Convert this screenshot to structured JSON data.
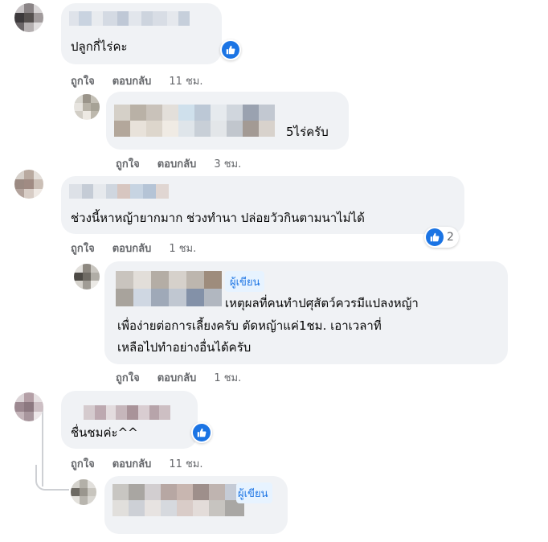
{
  "comments": [
    {
      "text": "ปลูกกี่ไร่คะ",
      "actions": {
        "like": "ถูกใจ",
        "reply": "ตอบกลับ",
        "time": "11 ชม."
      }
    },
    {
      "text": "5ไร่ครับ",
      "actions": {
        "like": "ถูกใจ",
        "reply": "ตอบกลับ",
        "time": "3 ชม."
      }
    },
    {
      "text": "ช่วงนี้หาหญ้ายากมาก ช่วงทำนา ปล่อยวัวกินตามนาไม่ได้",
      "reaction_count": "2",
      "actions": {
        "like": "ถูกใจ",
        "reply": "ตอบกลับ",
        "time": "1 ชม."
      }
    },
    {
      "author_badge": "ผู้เขียน",
      "lines": [
        "เหตุผลที่คนทำปศุสัตว์ควรมีแปลงหญ้า",
        "เพื่อง่ายต่อการเลี้ยงครับ ตัดหญ้าแค่1ชม. เอาเวลาที่",
        "เหลือไปทำอย่างอื่นได้ครับ"
      ],
      "actions": {
        "like": "ถูกใจ",
        "reply": "ตอบกลับ",
        "time": "1 ชม."
      }
    },
    {
      "text": "ชื่นชมค่ะ^^",
      "actions": {
        "like": "ถูกใจ",
        "reply": "ตอบกลับ",
        "time": "11 ชม."
      }
    },
    {
      "author_badge": "ผู้เขียน"
    }
  ],
  "colors": {
    "like_blue": "#1b74e4",
    "bubble_bg": "#f0f2f5",
    "meta_gray": "#65676b"
  }
}
